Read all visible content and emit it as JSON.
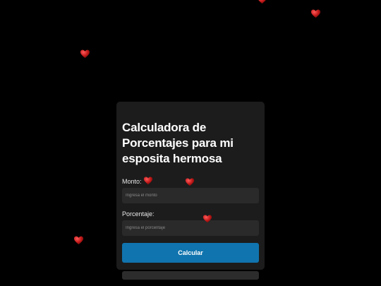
{
  "page": {
    "background": "#000000"
  },
  "card": {
    "title": "Calculadora de Porcentajes para mi esposita hermosa",
    "background": "#1c1c1c"
  },
  "form": {
    "monto_label": "Monto:",
    "monto_placeholder": "Ingresa el monto",
    "monto_value": "",
    "porcentaje_label": "Porcentaje:",
    "porcentaje_placeholder": "Ingresa el porcentaje",
    "porcentaje_value": "",
    "calcular_label": "Calcular",
    "button_color": "#1074ae"
  },
  "result": {
    "text": ""
  },
  "decorations": {
    "icon": "heart-icon",
    "heart_color": "#b81414",
    "count": 8
  }
}
